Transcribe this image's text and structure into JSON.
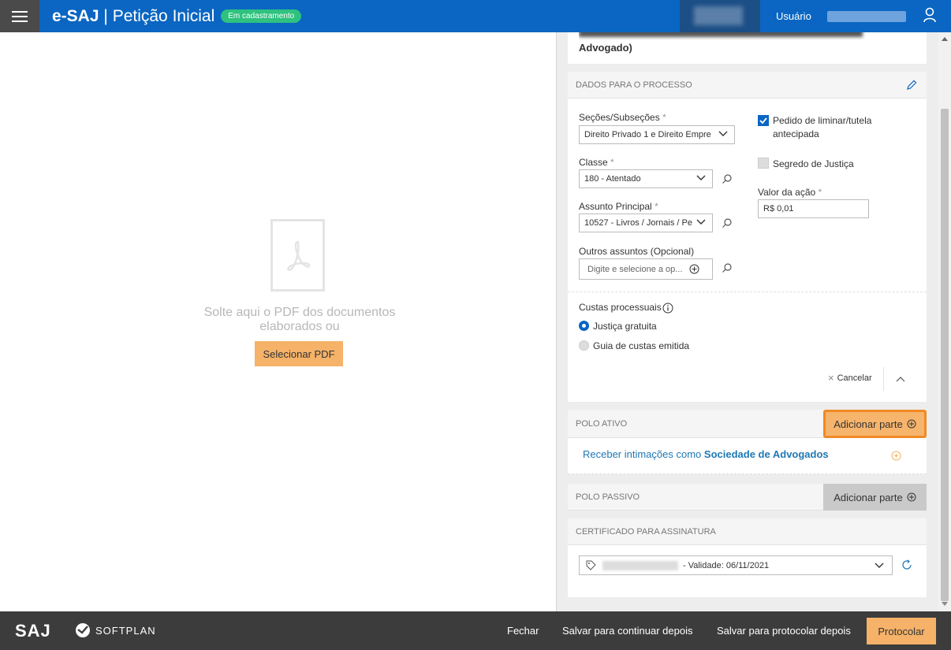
{
  "header": {
    "app_name": "e-SAJ",
    "separator": "|",
    "page_title": "Petição Inicial",
    "status_badge": "Em cadastramento",
    "user_label": "Usuário"
  },
  "left": {
    "drop_text": "Solte aqui o PDF dos documentos elaborados ou",
    "select_pdf_button": "Selecionar PDF"
  },
  "top_card": {
    "line2": "Advogado)"
  },
  "dados": {
    "header": "DADOS PARA O PROCESSO",
    "secoes_label": "Seções/Subseções",
    "secoes_value": "Direito Privado 1 e Direito Empre",
    "classe_label": "Classe",
    "classe_value": "180 - Atentado",
    "assunto_label": "Assunto Principal",
    "assunto_value": "10527 - Livros / Jornais / Pe",
    "outros_label": "Outros assuntos (Opcional)",
    "outros_placeholder": "Digite e selecione a op...",
    "required_mark": "*",
    "liminar_label_1": "Pedido de liminar/tutela",
    "liminar_label_2": "antecipada",
    "segredo_label": "Segredo de Justiça",
    "valor_label": "Valor da ação",
    "valor_value": "R$ 0,01",
    "custas_label": "Custas processuais",
    "radio_gratuita": "Justiça gratuita",
    "radio_guia": "Guia de custas emitida",
    "cancel_label": "Cancelar",
    "cancel_x": "×"
  },
  "polo_ativo": {
    "header": "POLO ATIVO",
    "add_button": "Adicionar parte",
    "link_prefix": "Receber intimações como",
    "link_bold": "Sociedade de Advogados"
  },
  "polo_passivo": {
    "header": "POLO PASSIVO",
    "add_button": "Adicionar parte"
  },
  "certificado": {
    "header": "CERTIFICADO PARA ASSINATURA",
    "validade": "- Validade: 06/11/2021"
  },
  "footer": {
    "logo_saj": "SAJ",
    "logo_softplan": "SOFTPLAN",
    "fechar": "Fechar",
    "salvar_continuar": "Salvar para continuar depois",
    "salvar_protocolar": "Salvar para protocolar depois",
    "protocolar": "Protocolar"
  },
  "colors": {
    "topbar": "#0a66c2",
    "badge": "#2ec27e",
    "accent_orange": "#f5b268",
    "highlight_border": "#f08a24",
    "link_blue": "#1f78b4",
    "footer": "#3c3c3c"
  }
}
